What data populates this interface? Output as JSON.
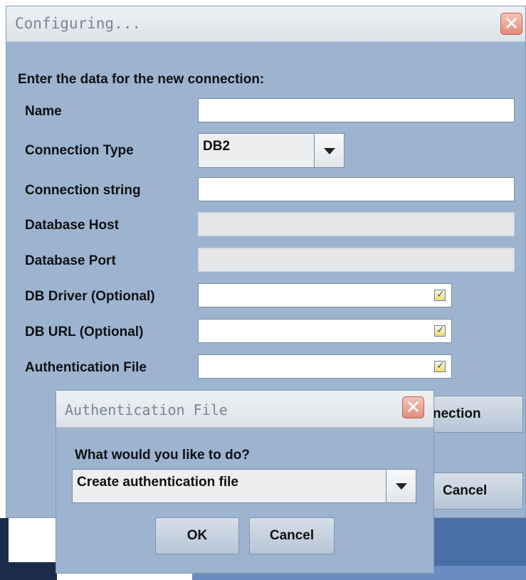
{
  "main_dialog": {
    "title": "Configuring...",
    "prompt": "Enter the data for the new connection:",
    "fields": {
      "name_label": "Name",
      "name_value": "",
      "connection_type_label": "Connection Type",
      "connection_type_value": "DB2",
      "connection_string_label": "Connection string",
      "connection_string_value": "",
      "database_host_label": "Database Host",
      "database_port_label": "Database Port",
      "db_driver_label": "DB Driver (Optional)",
      "db_url_label": "DB URL (Optional)",
      "auth_file_label": "Authentication File"
    },
    "buttons": {
      "test_connection_visible": "nection",
      "cancel": "Cancel"
    }
  },
  "auth_dialog": {
    "title": "Authentication File",
    "prompt": "What would you like to do?",
    "action_value": "Create authentication file",
    "ok": "OK",
    "cancel": "Cancel"
  },
  "colors": {
    "dialog_bg": "#9cb4d0",
    "titlebar_bg": "#e6eaee",
    "close_button": "#e28c7b",
    "desktop_blue": "#4a6fa8"
  }
}
